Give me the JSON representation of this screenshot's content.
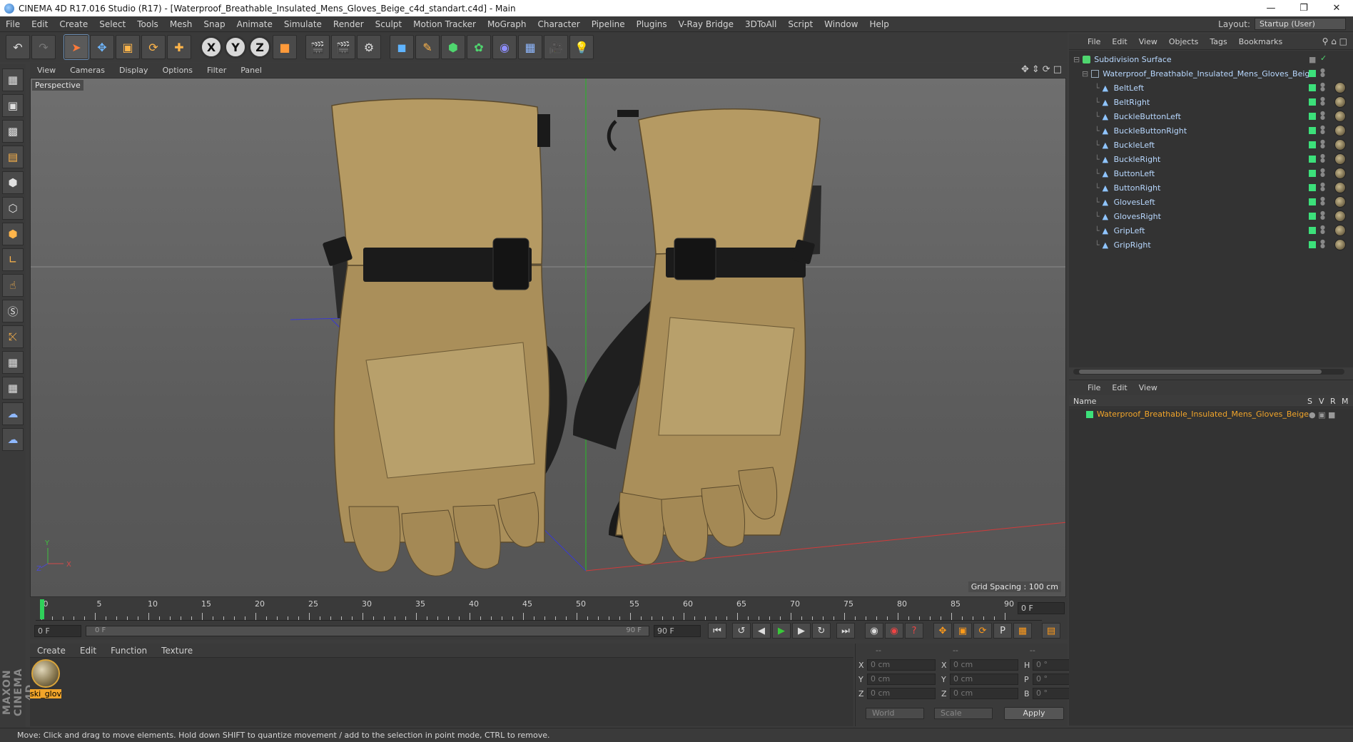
{
  "window": {
    "title": "CINEMA 4D R17.016 Studio (R17) - [Waterproof_Breathable_Insulated_Mens_Gloves_Beige_c4d_standart.c4d] - Main"
  },
  "menubar": {
    "items": [
      "File",
      "Edit",
      "Create",
      "Select",
      "Tools",
      "Mesh",
      "Snap",
      "Animate",
      "Simulate",
      "Render",
      "Sculpt",
      "Motion Tracker",
      "MoGraph",
      "Character",
      "Pipeline",
      "Plugins",
      "V-Ray Bridge",
      "3DToAll",
      "Script",
      "Window",
      "Help"
    ],
    "layout_label": "Layout:",
    "layout_value": "Startup (User)"
  },
  "toolbar": {
    "axis_x": "X",
    "axis_y": "Y",
    "axis_z": "Z"
  },
  "viewport": {
    "menus": [
      "View",
      "Cameras",
      "Display",
      "Options",
      "Filter",
      "Panel"
    ],
    "camera_label": "Perspective",
    "grid_spacing": "Grid Spacing : 100 cm"
  },
  "timeline": {
    "ticks": [
      "0",
      "5",
      "10",
      "15",
      "20",
      "25",
      "30",
      "35",
      "40",
      "45",
      "50",
      "55",
      "60",
      "65",
      "70",
      "75",
      "80",
      "85",
      "90"
    ],
    "current_frame": "0 F"
  },
  "playback": {
    "start_field": "0 F",
    "slider_start": "0 F",
    "slider_end": "90 F",
    "end_field": "90 F"
  },
  "materials": {
    "menus": [
      "Create",
      "Edit",
      "Function",
      "Texture"
    ],
    "items": [
      {
        "name": "ski_glov"
      }
    ]
  },
  "coordinates": {
    "header": [
      "--",
      "--",
      "--"
    ],
    "rows": [
      {
        "l1": "X",
        "v1": "0 cm",
        "l2": "X",
        "v2": "0 cm",
        "l3": "H",
        "v3": "0 °"
      },
      {
        "l1": "Y",
        "v1": "0 cm",
        "l2": "Y",
        "v2": "0 cm",
        "l3": "P",
        "v3": "0 °"
      },
      {
        "l1": "Z",
        "v1": "0 cm",
        "l2": "Z",
        "v2": "0 cm",
        "l3": "B",
        "v3": "0 °"
      }
    ],
    "world_dropdown": "World",
    "scale_dropdown": "Scale",
    "apply": "Apply"
  },
  "statusbar": {
    "text": "Move: Click and drag to move elements. Hold down SHIFT to quantize movement / add to the selection in point mode, CTRL to remove."
  },
  "object_manager": {
    "menus": [
      "File",
      "Edit",
      "View",
      "Objects",
      "Tags",
      "Bookmarks"
    ],
    "root": "Subdivision Surface",
    "group": "Waterproof_Breathable_Insulated_Mens_Gloves_Beige",
    "children": [
      "BeltLeft",
      "BeltRight",
      "BuckleButtonLeft",
      "BuckleButtonRight",
      "BuckleLeft",
      "BuckleRight",
      "ButtonLeft",
      "ButtonRight",
      "GlovesLeft",
      "GlovesRight",
      "GripLeft",
      "GripRight"
    ]
  },
  "attribute_manager": {
    "menus": [
      "File",
      "Edit",
      "View"
    ],
    "col_name": "Name",
    "col_s": "S",
    "col_v": "V",
    "col_r": "R",
    "col_m": "M",
    "row_name": "Waterproof_Breathable_Insulated_Mens_Gloves_Beige"
  },
  "colors": {
    "accent_orange": "#f2a52a",
    "layer_green": "#3ce07a",
    "glove_beige": "#b59a63",
    "strap_black": "#1b1b1b"
  }
}
